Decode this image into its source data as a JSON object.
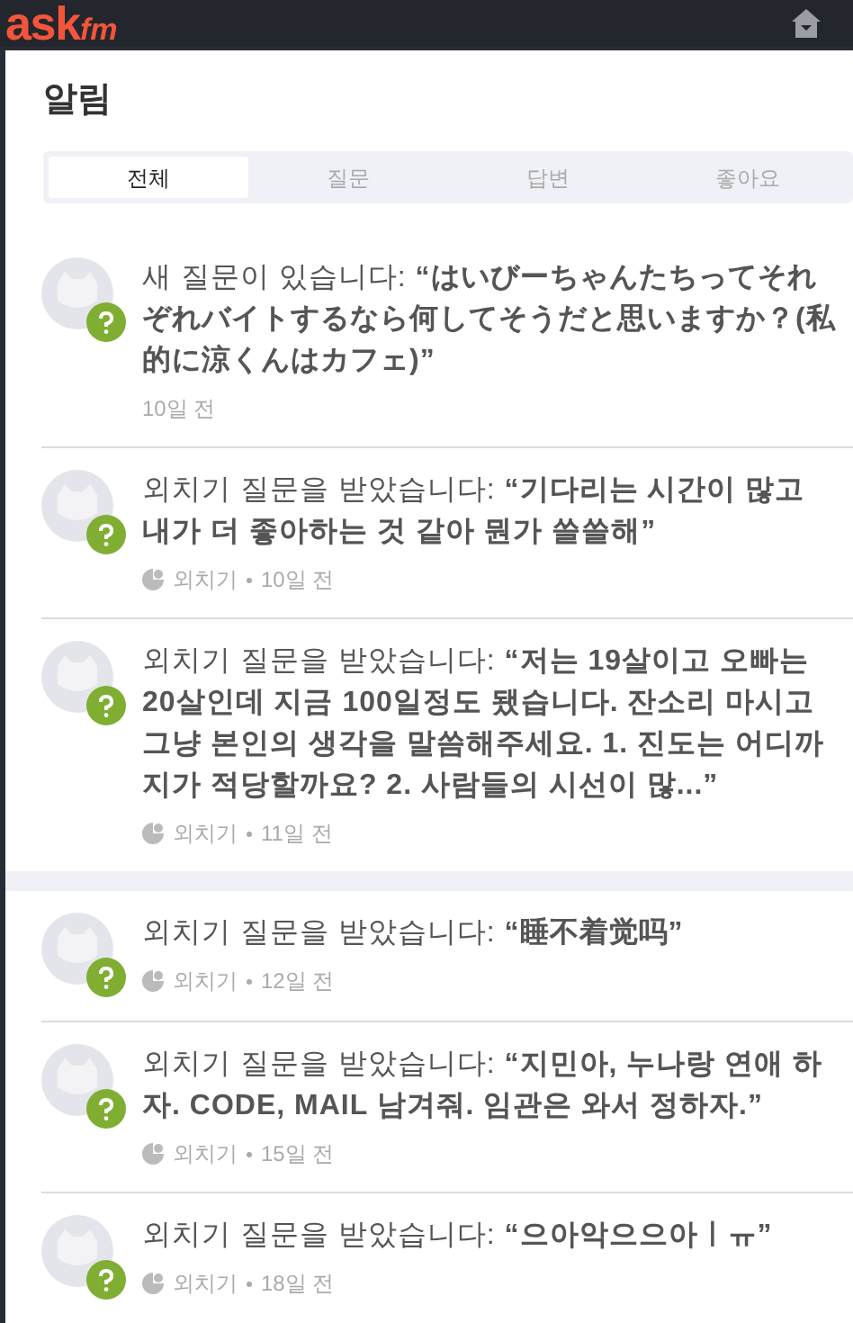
{
  "header": {
    "logo": {
      "main": "ask",
      "suffix": "fm"
    }
  },
  "page": {
    "title": "알림"
  },
  "tabs": [
    {
      "label": "전체",
      "selected": true
    },
    {
      "label": "질문",
      "selected": false
    },
    {
      "label": "답변",
      "selected": false
    },
    {
      "label": "좋아요",
      "selected": false
    }
  ],
  "groups": [
    {
      "notifications": [
        {
          "text": "새 질문이 있습니다: **“はいびーちゃんたちってそれぞれバイトするなら何してそうだと思いますか？(私的に涼くんはカフェ)”**",
          "time": "10일 전"
        },
        {
          "text": "외치기 질문을 받았습니다: **“기다리는 시간이 많고 내가 더 좋아하는 것 같아 뭔가 쓸쓸해”**",
          "author": "외치기",
          "time": "10일 전"
        },
        {
          "text": "외치기 질문을 받았습니다: **“저는 19살이고 오빠는 20살인데 지금 100일정도 됐습니다. 잔소리 마시고 그냥 본인의 생각을 말씀해주세요. 1. 진도는 어디까지가 적당할까요? 2. 사람들의 시선이 많...”**",
          "author": "외치기",
          "time": "11일 전"
        }
      ]
    },
    {
      "notifications": [
        {
          "text": "외치기 질문을 받았습니다: **“睡不着觉吗”**",
          "author": "외치기",
          "time": "12일 전"
        },
        {
          "text": "외치기 질문을 받았습니다: **“지민아, 누나랑 연애 하자. CODE, MAIL 남겨줘. 임관은 와서 정하자.”**",
          "author": "외치기",
          "time": "15일 전"
        },
        {
          "text": "외치기 질문을 받았습니다: **“으아악으으아ㅣㅠ”**",
          "author": "외치기",
          "time": "18일 전"
        }
      ]
    }
  ]
}
